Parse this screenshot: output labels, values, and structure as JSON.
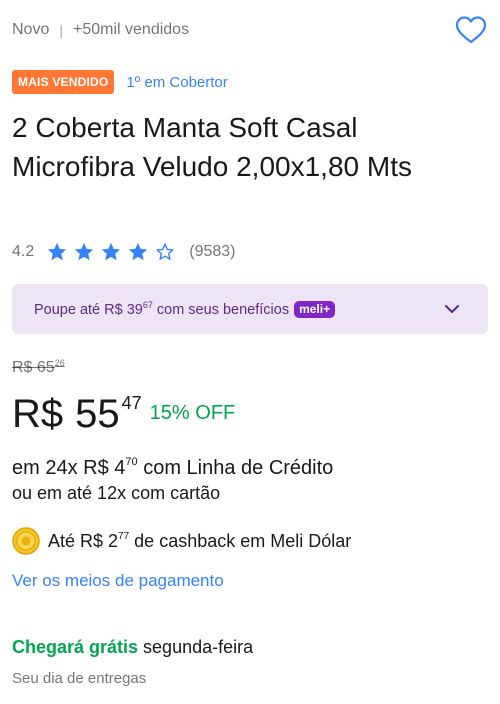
{
  "header": {
    "condition": "Novo",
    "separator": "|",
    "sold": "+50mil vendidos",
    "favorite_icon": "heart-outline-icon"
  },
  "badges": {
    "best_seller": "MAIS VENDIDO",
    "ranking": "1º em Cobertor"
  },
  "product": {
    "title": "2 Coberta Manta Soft Casal Microfibra Veludo 2,00x1,80 Mts"
  },
  "rating": {
    "score": "4.2",
    "stars_value": 4.2,
    "stars_max": 5,
    "count": "(9583)"
  },
  "benefits": {
    "text_pre": "Poupe até R$ 39",
    "cents": "67",
    "text_post": " com seus benefícios",
    "badge": "meli+",
    "chevron_icon": "chevron-down-icon"
  },
  "pricing": {
    "old_price": "R$ 65",
    "old_cents": "26",
    "currency": "R$",
    "price_int": "55",
    "price_cents": "47",
    "discount": "15% OFF",
    "installments_pre": "em 24x R$ 4",
    "installments_cents": "70",
    "installments_post": " com Linha de Crédito",
    "installments_card": "ou em até 12x com cartão"
  },
  "cashback": {
    "icon": "meli-dolar-coin-icon",
    "text_pre": "Até R$ 2",
    "cents": "77",
    "text_post": " de cashback em Meli Dólar"
  },
  "payment": {
    "link": "Ver os meios de pagamento"
  },
  "delivery": {
    "free": "Chegará grátis",
    "day": " segunda-feira",
    "sub": "Seu dia de entregas"
  },
  "colors": {
    "accent_blue": "#3483fa",
    "green": "#00a650",
    "orange_badge": "#ff7733",
    "purple": "#7f26c4",
    "benefits_bg": "#ede4f5"
  }
}
